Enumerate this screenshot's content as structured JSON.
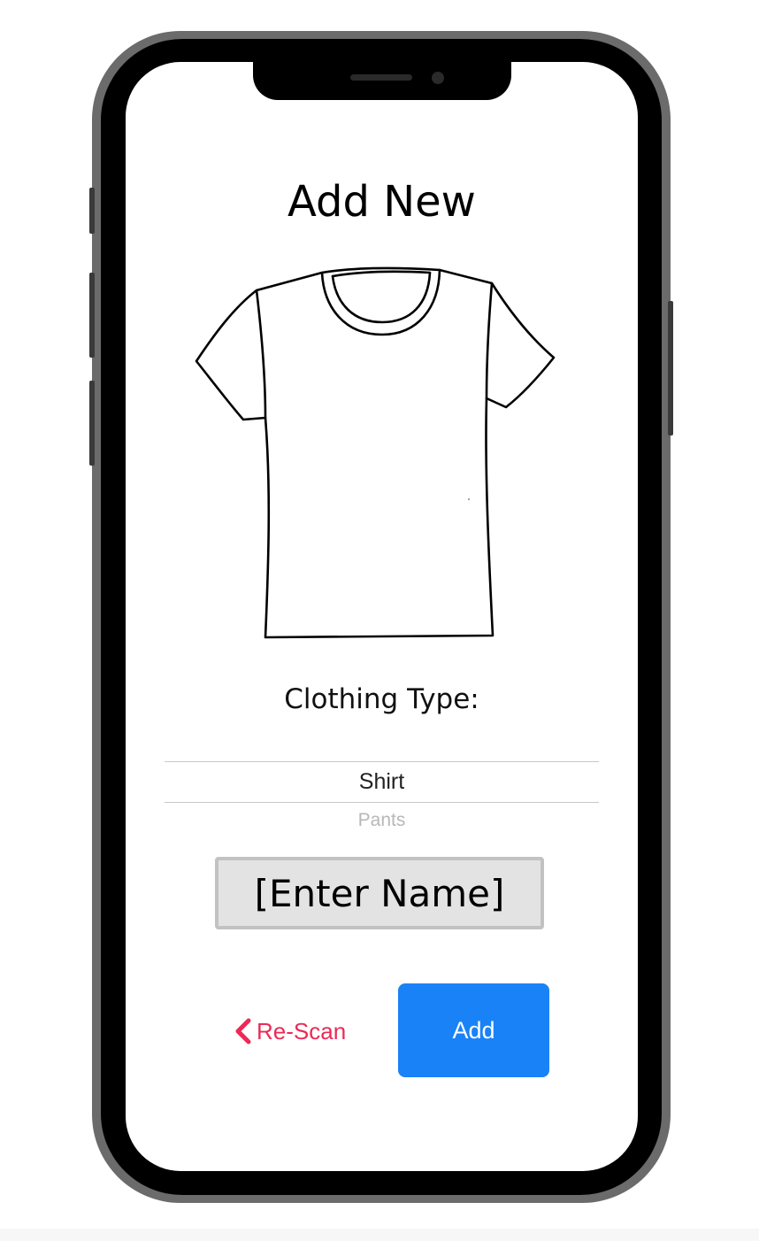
{
  "screen": {
    "title": "Add New",
    "image": {
      "icon": "tshirt-illustration"
    },
    "clothing_type": {
      "label": "Clothing Type:",
      "options": [
        "Shirt",
        "Pants"
      ],
      "selected": "Shirt"
    },
    "name_input": {
      "value": "[Enter Name]"
    },
    "actions": {
      "rescan_label": "Re-Scan",
      "rescan_icon": "chevron-left-icon",
      "add_label": "Add"
    }
  },
  "colors": {
    "accent_red": "#ec2a55",
    "primary_blue": "#1a82f7",
    "input_background": "#e3e3e3",
    "phone_frame": "#6b6b6b"
  }
}
